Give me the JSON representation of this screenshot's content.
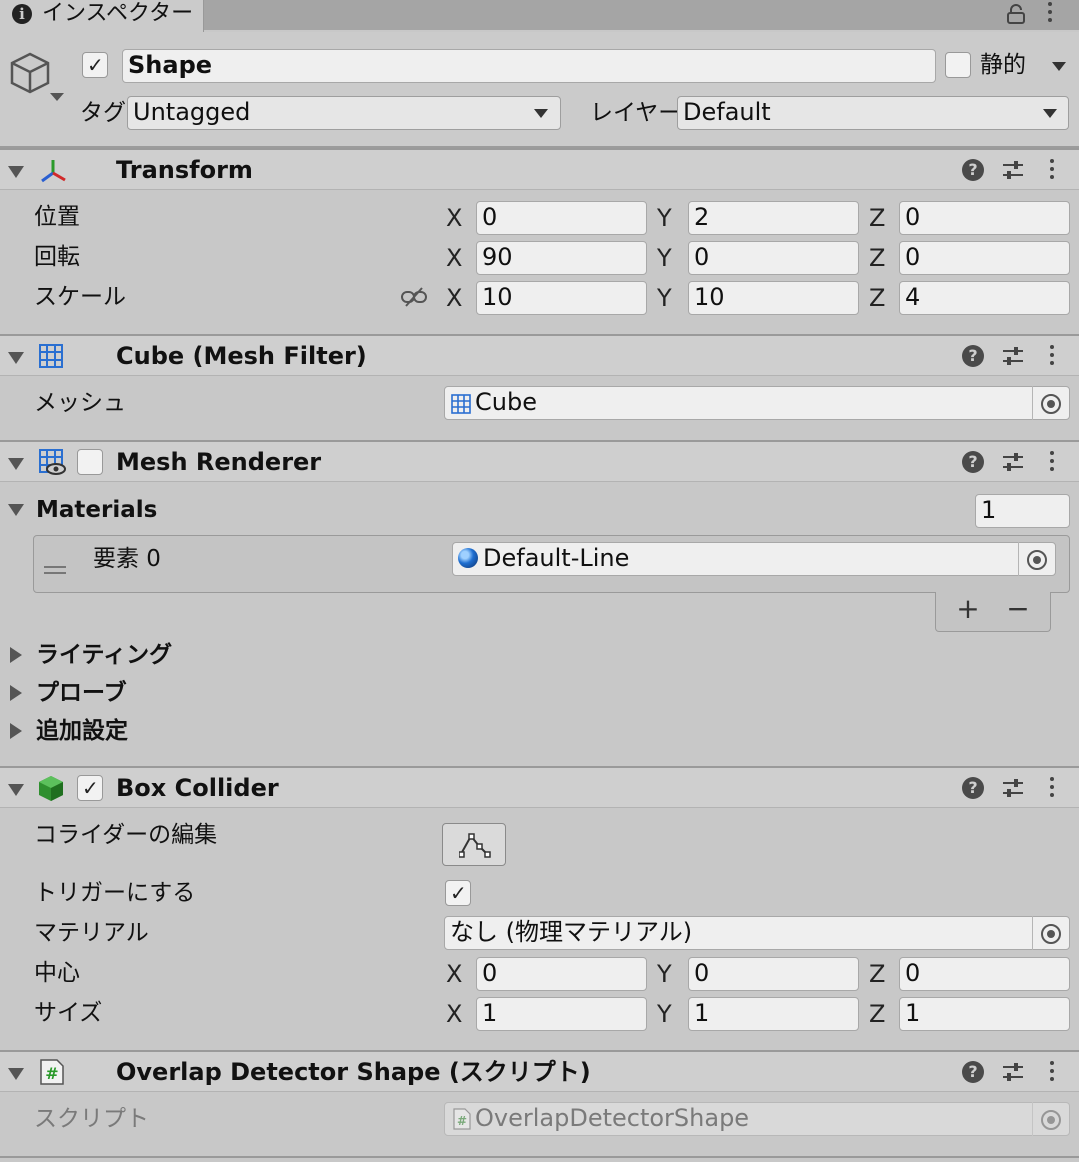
{
  "tab": {
    "title": "インスペクター"
  },
  "object": {
    "name": "Shape",
    "active": true,
    "static_label": "静的",
    "static": false,
    "tag_label": "タグ",
    "tag_value": "Untagged",
    "layer_label": "レイヤー",
    "layer_value": "Default"
  },
  "transform": {
    "title": "Transform",
    "rows": [
      {
        "label": "位置",
        "x": "0",
        "y": "2",
        "z": "0"
      },
      {
        "label": "回転",
        "x": "90",
        "y": "0",
        "z": "0"
      },
      {
        "label": "スケール",
        "x": "10",
        "y": "10",
        "z": "4"
      }
    ],
    "axis": {
      "x": "X",
      "y": "Y",
      "z": "Z"
    }
  },
  "mesh_filter": {
    "title": "Cube (Mesh Filter)",
    "mesh_label": "メッシュ",
    "mesh_value": "Cube"
  },
  "mesh_renderer": {
    "title": "Mesh Renderer",
    "enabled": false,
    "materials_label": "Materials",
    "materials_count": "1",
    "element_label": "要素 0",
    "element_value": "Default-Line",
    "add": "+",
    "remove": "−",
    "lighting": "ライティング",
    "probes": "プローブ",
    "additional": "追加設定"
  },
  "box_collider": {
    "title": "Box Collider",
    "enabled": true,
    "edit_label": "コライダーの編集",
    "trigger_label": "トリガーにする",
    "trigger": true,
    "material_label": "マテリアル",
    "material_value": "なし (物理マテリアル)",
    "center_label": "中心",
    "center": {
      "x": "0",
      "y": "0",
      "z": "0"
    },
    "size_label": "サイズ",
    "size": {
      "x": "1",
      "y": "1",
      "z": "1"
    }
  },
  "script_comp": {
    "title": "Overlap Detector Shape (スクリプト)",
    "script_label": "スクリプト",
    "script_value": "OverlapDetectorShape"
  },
  "colors": {
    "panel": "#c8c8c8",
    "header": "#cfcfcf",
    "field": "#efefef",
    "material_dot": "#1f6fd1",
    "collider_icon": "#3a9a3a"
  }
}
